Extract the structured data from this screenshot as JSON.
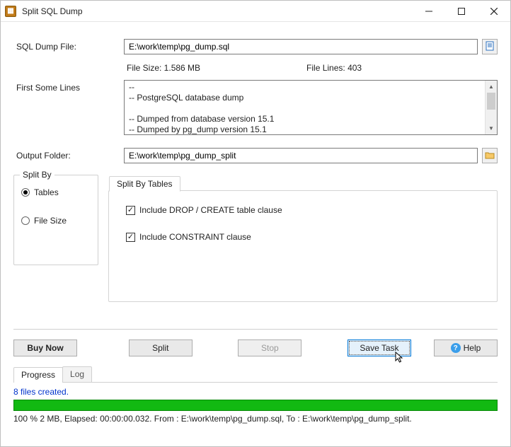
{
  "titlebar": {
    "title": "Split SQL Dump"
  },
  "labels": {
    "dump_file": "SQL Dump File:",
    "file_size": "File Size: 1.586 MB",
    "file_lines": "File Lines: 403",
    "first_lines": "First Some Lines",
    "output_folder": "Output Folder:"
  },
  "fields": {
    "dump_file_value": "E:\\work\\temp\\pg_dump.sql",
    "output_folder_value": "E:\\work\\temp\\pg_dump_split"
  },
  "preview": "--\n-- PostgreSQL database dump\n\n-- Dumped from database version 15.1\n-- Dumped by pg_dump version 15.1",
  "split_by": {
    "group_title": "Split By",
    "options": {
      "tables": "Tables",
      "file_size": "File Size"
    },
    "selected": "tables"
  },
  "tab": {
    "title": "Split By Tables",
    "include_drop": "Include DROP / CREATE table clause",
    "include_constraint": "Include CONSTRAINT clause",
    "include_drop_checked": true,
    "include_constraint_checked": true
  },
  "buttons": {
    "buy_now": "Buy Now",
    "split": "Split",
    "stop": "Stop",
    "save_task": "Save Task",
    "help": "Help"
  },
  "bottom_tabs": {
    "progress": "Progress",
    "log": "Log"
  },
  "progress": {
    "message": "8 files created.",
    "status": "100 %    2 MB,   Elapsed: 00:00:00.032.    From : E:\\work\\temp\\pg_dump.sql,    To : E:\\work\\temp\\pg_dump_split."
  }
}
